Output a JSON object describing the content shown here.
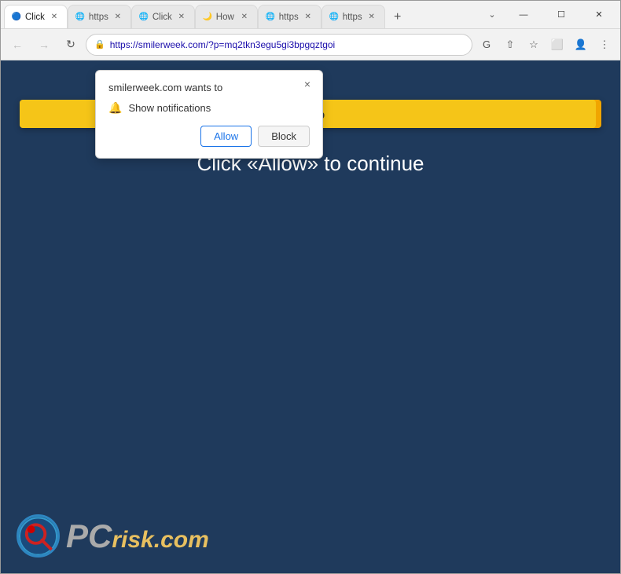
{
  "browser": {
    "tabs": [
      {
        "id": 1,
        "title": "Click",
        "icon": "🔵",
        "active": true
      },
      {
        "id": 2,
        "title": "https",
        "icon": "🌐",
        "active": false
      },
      {
        "id": 3,
        "title": "Click",
        "icon": "🌐",
        "active": false
      },
      {
        "id": 4,
        "title": "How",
        "icon": "🌙",
        "active": false
      },
      {
        "id": 5,
        "title": "https",
        "icon": "🌐",
        "active": false
      },
      {
        "id": 6,
        "title": "https",
        "icon": "🌐",
        "active": false
      }
    ],
    "url": "https://smilerweek.com/?p=mq2tkn3egu5gi3bpgqztgoi",
    "controls": {
      "minimize": "—",
      "maximize": "☐",
      "close": "✕"
    }
  },
  "popup": {
    "title": "smilerweek.com wants to",
    "item": "Show notifications",
    "allow_label": "Allow",
    "block_label": "Block",
    "close_label": "×"
  },
  "page": {
    "progress_percent": "99%",
    "progress_value": 99,
    "main_text": "Click «Allow» to continue"
  },
  "logo": {
    "pc": "PC",
    "risk": "risk",
    "com": ".com"
  }
}
